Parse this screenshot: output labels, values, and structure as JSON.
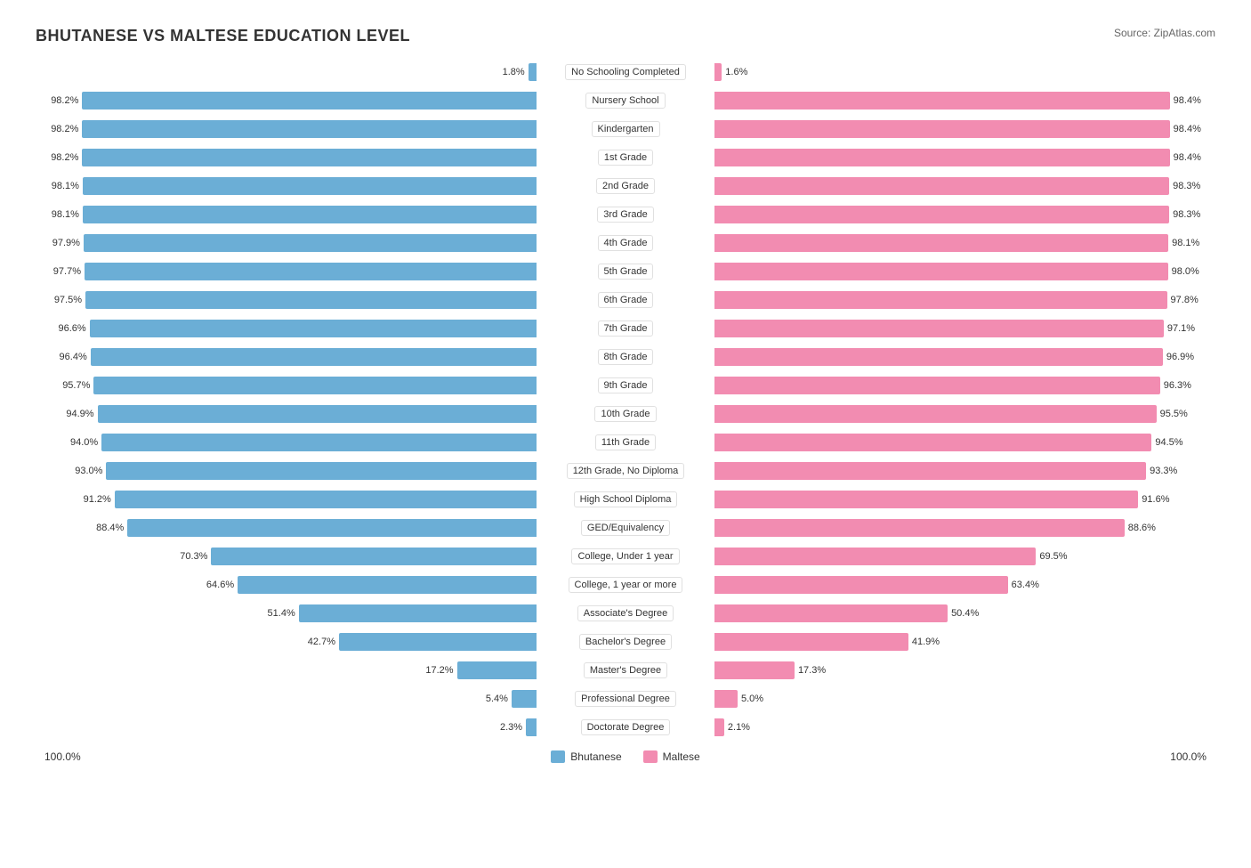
{
  "title": "BHUTANESE VS MALTESE EDUCATION LEVEL",
  "source": "Source: ZipAtlas.com",
  "colors": {
    "blue": "#6baed6",
    "pink": "#f28cb1"
  },
  "legend": {
    "blue_label": "Bhutanese",
    "pink_label": "Maltese"
  },
  "footer": {
    "left": "100.0%",
    "right": "100.0%"
  },
  "rows": [
    {
      "label": "No Schooling Completed",
      "left_val": "1.8%",
      "right_val": "1.6%",
      "left_pct": 1.8,
      "right_pct": 1.6
    },
    {
      "label": "Nursery School",
      "left_val": "98.2%",
      "right_val": "98.4%",
      "left_pct": 98.2,
      "right_pct": 98.4
    },
    {
      "label": "Kindergarten",
      "left_val": "98.2%",
      "right_val": "98.4%",
      "left_pct": 98.2,
      "right_pct": 98.4
    },
    {
      "label": "1st Grade",
      "left_val": "98.2%",
      "right_val": "98.4%",
      "left_pct": 98.2,
      "right_pct": 98.4
    },
    {
      "label": "2nd Grade",
      "left_val": "98.1%",
      "right_val": "98.3%",
      "left_pct": 98.1,
      "right_pct": 98.3
    },
    {
      "label": "3rd Grade",
      "left_val": "98.1%",
      "right_val": "98.3%",
      "left_pct": 98.1,
      "right_pct": 98.3
    },
    {
      "label": "4th Grade",
      "left_val": "97.9%",
      "right_val": "98.1%",
      "left_pct": 97.9,
      "right_pct": 98.1
    },
    {
      "label": "5th Grade",
      "left_val": "97.7%",
      "right_val": "98.0%",
      "left_pct": 97.7,
      "right_pct": 98.0
    },
    {
      "label": "6th Grade",
      "left_val": "97.5%",
      "right_val": "97.8%",
      "left_pct": 97.5,
      "right_pct": 97.8
    },
    {
      "label": "7th Grade",
      "left_val": "96.6%",
      "right_val": "97.1%",
      "left_pct": 96.6,
      "right_pct": 97.1
    },
    {
      "label": "8th Grade",
      "left_val": "96.4%",
      "right_val": "96.9%",
      "left_pct": 96.4,
      "right_pct": 96.9
    },
    {
      "label": "9th Grade",
      "left_val": "95.7%",
      "right_val": "96.3%",
      "left_pct": 95.7,
      "right_pct": 96.3
    },
    {
      "label": "10th Grade",
      "left_val": "94.9%",
      "right_val": "95.5%",
      "left_pct": 94.9,
      "right_pct": 95.5
    },
    {
      "label": "11th Grade",
      "left_val": "94.0%",
      "right_val": "94.5%",
      "left_pct": 94.0,
      "right_pct": 94.5
    },
    {
      "label": "12th Grade, No Diploma",
      "left_val": "93.0%",
      "right_val": "93.3%",
      "left_pct": 93.0,
      "right_pct": 93.3
    },
    {
      "label": "High School Diploma",
      "left_val": "91.2%",
      "right_val": "91.6%",
      "left_pct": 91.2,
      "right_pct": 91.6
    },
    {
      "label": "GED/Equivalency",
      "left_val": "88.4%",
      "right_val": "88.6%",
      "left_pct": 88.4,
      "right_pct": 88.6
    },
    {
      "label": "College, Under 1 year",
      "left_val": "70.3%",
      "right_val": "69.5%",
      "left_pct": 70.3,
      "right_pct": 69.5
    },
    {
      "label": "College, 1 year or more",
      "left_val": "64.6%",
      "right_val": "63.4%",
      "left_pct": 64.6,
      "right_pct": 63.4
    },
    {
      "label": "Associate's Degree",
      "left_val": "51.4%",
      "right_val": "50.4%",
      "left_pct": 51.4,
      "right_pct": 50.4
    },
    {
      "label": "Bachelor's Degree",
      "left_val": "42.7%",
      "right_val": "41.9%",
      "left_pct": 42.7,
      "right_pct": 41.9
    },
    {
      "label": "Master's Degree",
      "left_val": "17.2%",
      "right_val": "17.3%",
      "left_pct": 17.2,
      "right_pct": 17.3
    },
    {
      "label": "Professional Degree",
      "left_val": "5.4%",
      "right_val": "5.0%",
      "left_pct": 5.4,
      "right_pct": 5.0
    },
    {
      "label": "Doctorate Degree",
      "left_val": "2.3%",
      "right_val": "2.1%",
      "left_pct": 2.3,
      "right_pct": 2.1
    }
  ]
}
